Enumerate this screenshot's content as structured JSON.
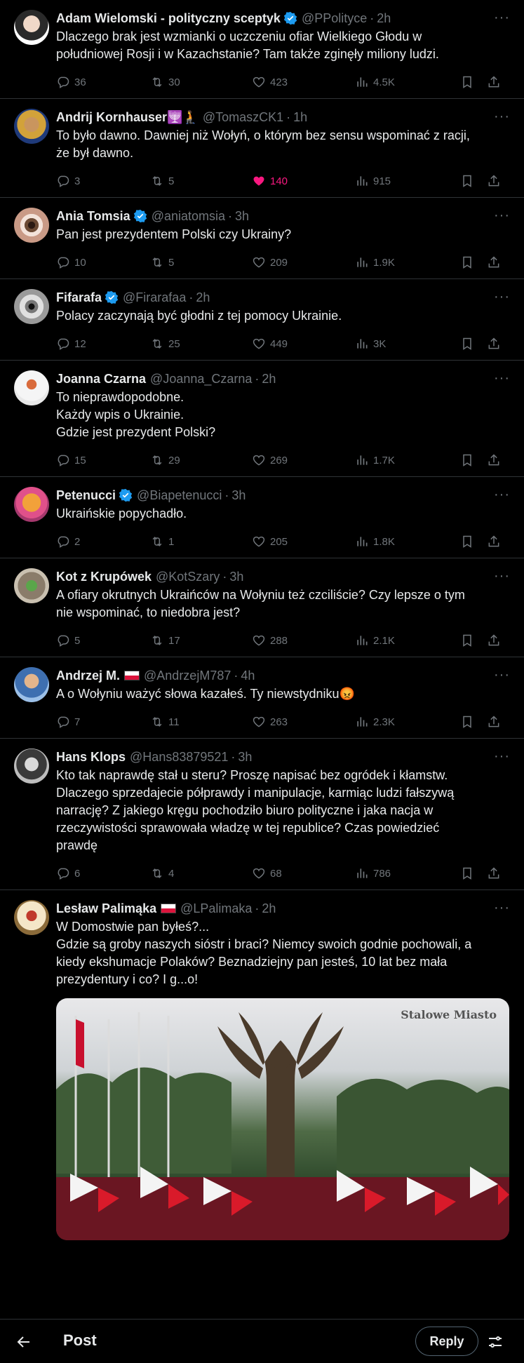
{
  "colors": {
    "background": "#000000",
    "text": "#e7e9ea",
    "muted": "#71767b",
    "verified": "#1d9bf0",
    "like": "#f91880",
    "divider": "#2f3336"
  },
  "tweets": [
    {
      "name": "Adam Wielomski - polityczny sceptyk",
      "handle": "@PPolityce",
      "time": "2h",
      "text": "Dlaczego brak jest wzmianki o uczczeniu ofiar Wielkiego Głodu w\npołudniowej Rosji i w Kazachstanie? Tam także zginęły miliony ludzi.",
      "replies": "36",
      "reposts": "30",
      "likes": "423",
      "views": "4.5K"
    },
    {
      "name": "Andrij Kornhauser🕎🧎",
      "handle": "@TomaszCK1",
      "time": "1h",
      "text": "To było dawno. Dawniej niż Wołyń, o którym bez sensu wspominać z racji,\nże był dawno.",
      "replies": "3",
      "reposts": "5",
      "likes": "140",
      "views": "915"
    },
    {
      "name": "Ania Tomsia",
      "handle": "@aniatomsia",
      "time": "3h",
      "text": "Pan jest prezydentem Polski czy Ukrainy?",
      "replies": "10",
      "reposts": "5",
      "likes": "209",
      "views": "1.9K"
    },
    {
      "name": "Fifarafa",
      "handle": "@Firarafaa",
      "time": "2h",
      "text": "Polacy zaczynają być głodni z tej pomocy Ukrainie.",
      "replies": "12",
      "reposts": "25",
      "likes": "449",
      "views": "3K"
    },
    {
      "name": "Joanna Czarna",
      "handle": "@Joanna_Czarna",
      "time": "2h",
      "text": "To nieprawdopodobne.\nKażdy wpis o Ukrainie.\nGdzie jest prezydent Polski?",
      "replies": "15",
      "reposts": "29",
      "likes": "269",
      "views": "1.7K"
    },
    {
      "name": "Petenucci",
      "handle": "@Biapetenucci",
      "time": "3h",
      "text": "Ukraińskie popychadło.",
      "replies": "2",
      "reposts": "1",
      "likes": "205",
      "views": "1.8K"
    },
    {
      "name": "Kot z Krupówek",
      "handle": "@KotSzary",
      "time": "3h",
      "text": "A ofiary okrutnych Ukraińców na Wołyniu też czciliście? Czy lepsze o tym\nnie wspominać, to niedobra jest?",
      "replies": "5",
      "reposts": "17",
      "likes": "288",
      "views": "2.1K"
    },
    {
      "name": "Andrzej M.",
      "handle": "@AndrzejM787",
      "time": "4h",
      "text": "A o Wołyniu ważyć słowa kazałeś. Ty niewstydniku😡",
      "replies": "7",
      "reposts": "11",
      "likes": "263",
      "views": "2.3K"
    },
    {
      "name": "Hans Klops",
      "handle": "@Hans83879521",
      "time": "3h",
      "text": "Kto tak naprawdę stał u steru? Proszę napisać bez ogródek i kłamstw.\nDlaczego sprzedajecie półprawdy i manipulacje, karmiąc ludzi fałszywą\nnarrację? Z jakiego kręgu pochodziło biuro polityczne i jaka nacja w\nrzeczywistości sprawowała władzę w tej republice? Czas powiedzieć\nprawdę",
      "replies": "6",
      "reposts": "4",
      "likes": "68",
      "views": "786"
    },
    {
      "name": "Lesław Palimąka",
      "handle": "@LPalimaka",
      "time": "2h",
      "text": "W Domostwie pan byłeś?...\nGdzie są groby naszych sióstr i braci? Niemcy swoich godnie pochowali, a\nkiedy ekshumacje Polaków? Beznadziejny pan jesteś, 10 lat bez mała\nprezydentury i co? I g...o!",
      "media_watermark": "Stalowe Miasto"
    }
  ],
  "bottom_bar": {
    "title": "Post",
    "reply_label": "Reply"
  }
}
